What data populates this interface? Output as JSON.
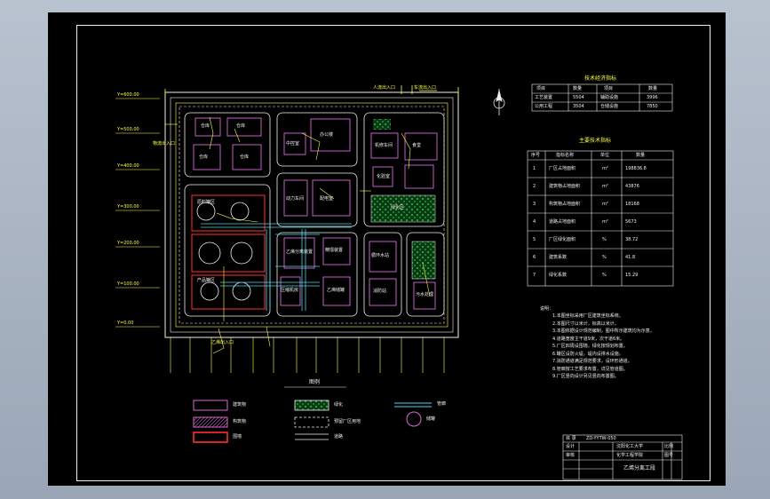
{
  "drawing": {
    "title_code": "ZD-YYTW-050",
    "title_name": "乙烯分离工段",
    "sheet_no": "1"
  },
  "coordinates": {
    "y_labels": [
      "Y=600.00",
      "Y=500.00",
      "Y=400.00",
      "Y=300.00",
      "Y=200.00",
      "Y=100.00",
      "Y=0.00"
    ]
  },
  "gate_labels": [
    "人流出入口",
    "车流出入口",
    "物流出入口",
    "乙烯出入口"
  ],
  "buildings": {
    "top_left": [
      "仓库",
      "仓库",
      "仓库",
      "仓库"
    ],
    "top_mid": [
      "中控室",
      "办公楼"
    ],
    "top_right": [
      "机修车间",
      "食堂",
      "化验室"
    ],
    "mid_mid": [
      "动力车间",
      "配电室"
    ],
    "tanks": [
      "原料罐区",
      "产品罐区"
    ],
    "process": [
      "乙烯分离装置",
      "精馏装置",
      "压缩机房",
      "乙烯储罐"
    ],
    "right_low": [
      "循环水站",
      "消防站",
      "污水处理"
    ],
    "green_label": "绿化区"
  },
  "tables": {
    "table1": {
      "title": "技术经济指标",
      "headers": [
        "项目",
        "数量",
        "项目",
        "数量"
      ],
      "rows": [
        [
          "工艺装置",
          "5504",
          "辅助设施",
          "3996"
        ],
        [
          "公用工程",
          "3504",
          "仓储设施",
          "7850"
        ]
      ]
    },
    "table2": {
      "title": "主要技术指标",
      "headers": [
        "序号",
        "指标名称",
        "单位",
        "数量"
      ],
      "rows": [
        [
          "1",
          "厂区占地面积",
          "m²",
          "198836.8"
        ],
        [
          "2",
          "建筑物占地面积",
          "m²",
          "43876"
        ],
        [
          "3",
          "构筑物占地面积",
          "m²",
          "18168"
        ],
        [
          "4",
          "道路占地面积",
          "m²",
          "5673"
        ],
        [
          "5",
          "厂区绿化面积",
          "%",
          "38.72"
        ],
        [
          "6",
          "建筑系数",
          "%",
          "41.8"
        ],
        [
          "7",
          "绿化系数",
          "%",
          "15.29"
        ]
      ]
    }
  },
  "notes": {
    "title": "说明：",
    "lines": [
      "1.本图坐标采用厂区建筑坐标系统。",
      "2.本图尺寸以米计，标高以米计。",
      "3.本图依据设计规范编制，图中所示建筑均为示意。",
      "4.道路宽度主干道9米，次干道6米。",
      "5.厂区四周设围墙，绿化按规划布置。",
      "6.罐区设防火堤，堤内设排水设施。",
      "7.消防通道满足规范要求，设环形通道。",
      "8.管廊按工艺要求布置，详见管道图。",
      "9.厂区竖向设计另见竖向布置图。"
    ]
  },
  "legend": {
    "title": "图例",
    "items": [
      "建筑物",
      "构筑物",
      "围墙",
      "绿化",
      "预留厂区用地",
      "道路",
      "管廊",
      "储罐"
    ]
  },
  "title_block": {
    "top_row": "目 录",
    "code": "ZD-YYTW-050",
    "school": "沈阳化工大学",
    "dept": "化学工程学院",
    "drawn": "设计",
    "checked": "审核",
    "scale": "比例",
    "sheet": "图号",
    "name": "乙烯分离工段"
  },
  "colors": {
    "background": "#000000",
    "border": "#f0f0f0",
    "building": "#d66ad6",
    "road": "#f0f0f0",
    "pipe": "#49d6e6",
    "annot": "#ffff40",
    "fence_red": "#ff3030",
    "green": "#1c8a2c"
  }
}
